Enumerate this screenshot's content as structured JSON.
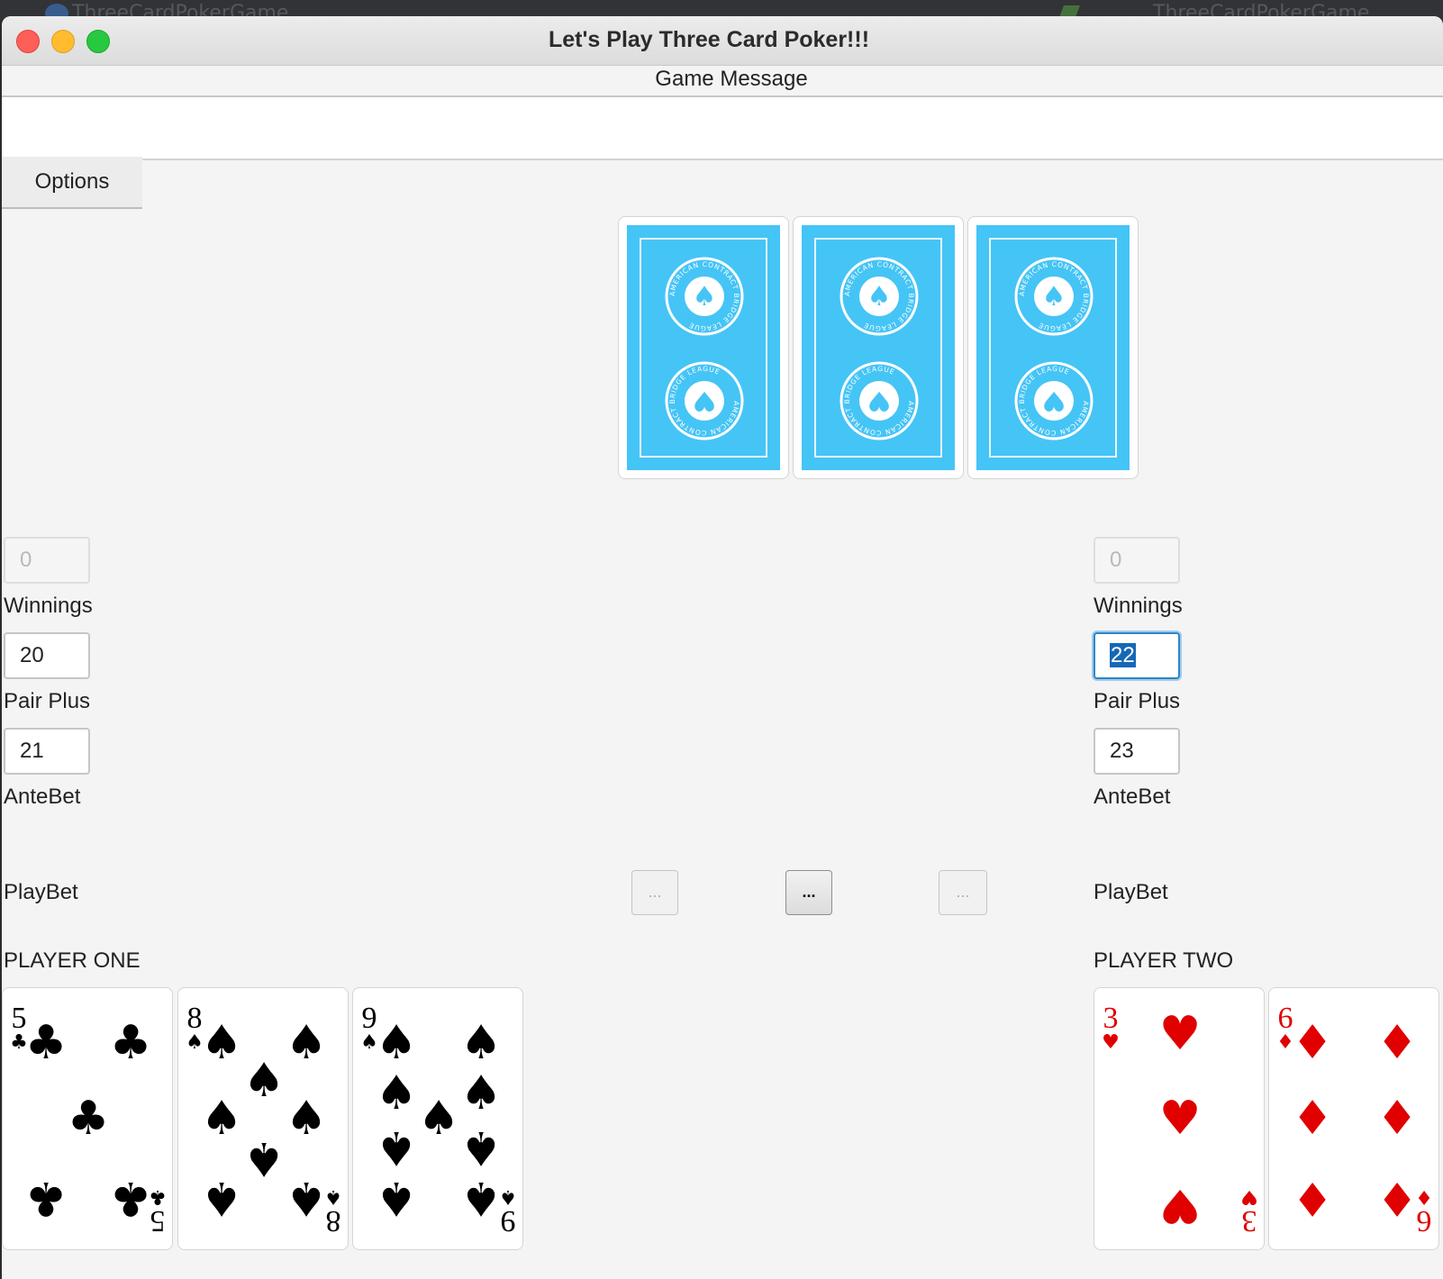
{
  "background": {
    "app_label": "ThreeCardPokerGame",
    "tab_label": "ThreeCardPokerGame"
  },
  "window": {
    "title": "Let's Play Three Card Poker!!!"
  },
  "game_message": {
    "label": "Game Message",
    "text": ""
  },
  "menu": {
    "options_label": "Options"
  },
  "dealer": {
    "cards": [
      {
        "face": "back",
        "emblem_text": "AMERICAN CONTRACT BRIDGE LEAGUE"
      },
      {
        "face": "back",
        "emblem_text": "AMERICAN CONTRACT BRIDGE LEAGUE"
      },
      {
        "face": "back",
        "emblem_text": "AMERICAN CONTRACT BRIDGE LEAGUE"
      }
    ]
  },
  "player_one": {
    "name": "PLAYER ONE",
    "winnings": {
      "label": "Winnings",
      "value": "0"
    },
    "pair_plus": {
      "label": "Pair Plus",
      "value": "20"
    },
    "ante_bet": {
      "label": "AnteBet",
      "value": "21"
    },
    "play_bet": {
      "label": "PlayBet"
    },
    "cards": [
      {
        "rank": "5",
        "suit": "club",
        "suit_symbol": "♣",
        "color": "#000000"
      },
      {
        "rank": "8",
        "suit": "spade",
        "suit_symbol": "♠",
        "color": "#000000"
      },
      {
        "rank": "9",
        "suit": "spade",
        "suit_symbol": "♠",
        "color": "#000000"
      }
    ]
  },
  "player_two": {
    "name": "PLAYER TWO",
    "winnings": {
      "label": "Winnings",
      "value": "0"
    },
    "pair_plus": {
      "label": "Pair Plus",
      "value": "22"
    },
    "ante_bet": {
      "label": "AnteBet",
      "value": "23"
    },
    "play_bet": {
      "label": "PlayBet"
    },
    "cards": [
      {
        "rank": "3",
        "suit": "heart",
        "suit_symbol": "♥",
        "color": "#e00000"
      },
      {
        "rank": "6",
        "suit": "diamond",
        "suit_symbol": "♦",
        "color": "#e00000"
      }
    ]
  },
  "action_buttons": [
    {
      "label": "...",
      "enabled": false
    },
    {
      "label": "...",
      "enabled": true
    },
    {
      "label": "...",
      "enabled": false
    }
  ],
  "colors": {
    "card_back": "#45c4f6",
    "focus_ring": "#2f86c6",
    "selection": "#1468b6",
    "red_suit": "#e00000"
  }
}
